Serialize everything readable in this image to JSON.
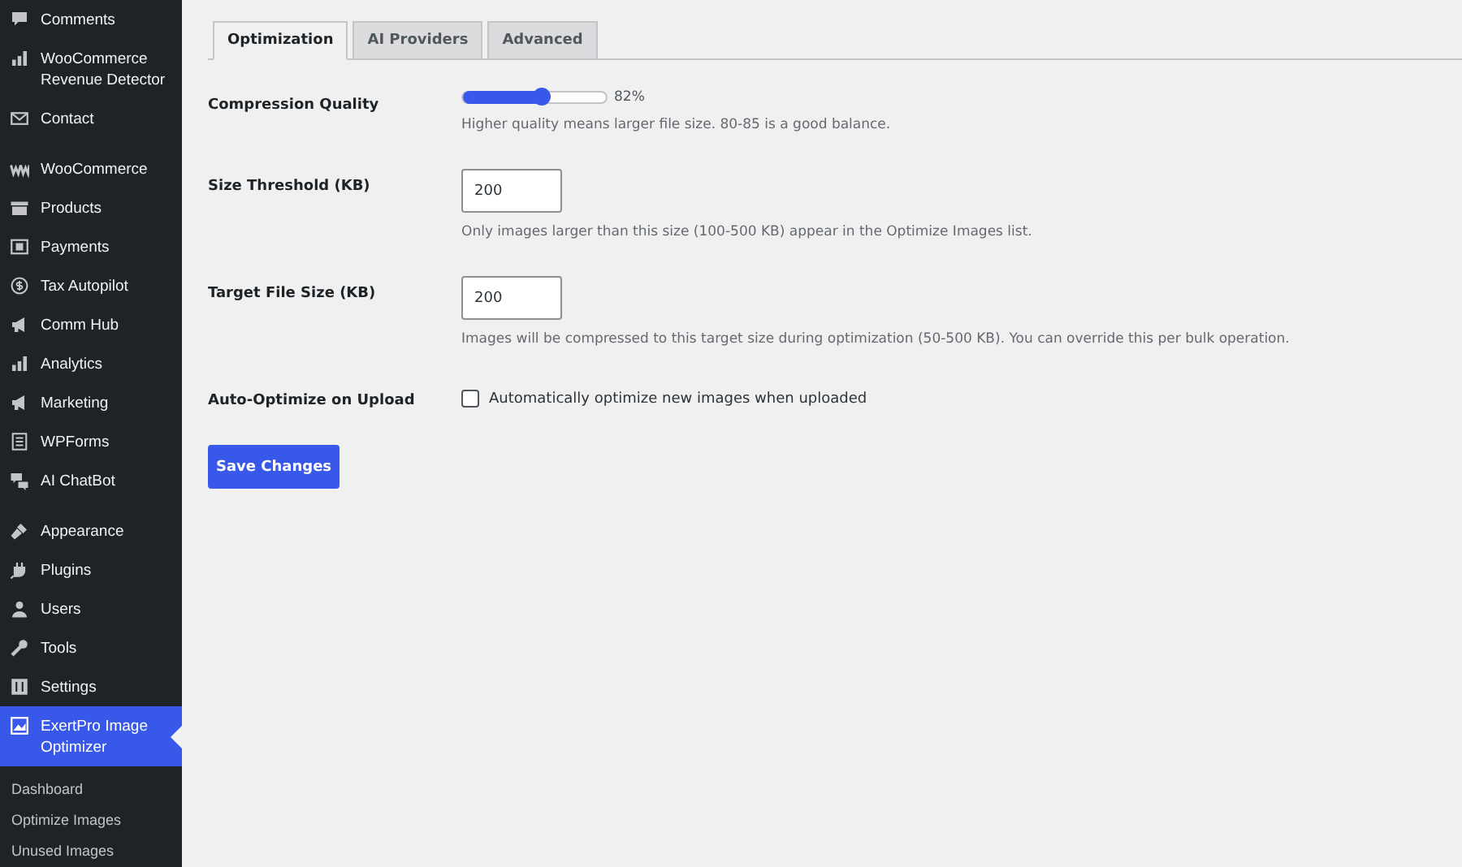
{
  "sidebar": {
    "groups": [
      [
        {
          "label": "Comments",
          "selected": false
        },
        {
          "label": "WooCommerce Revenue Detector",
          "selected": false
        },
        {
          "label": "Contact",
          "selected": false
        }
      ],
      [
        {
          "label": "WooCommerce",
          "selected": false
        },
        {
          "label": "Products",
          "selected": false
        },
        {
          "label": "Payments",
          "selected": false
        },
        {
          "label": "Tax Autopilot",
          "selected": false
        },
        {
          "label": "Comm Hub",
          "selected": false
        },
        {
          "label": "Analytics",
          "selected": false
        },
        {
          "label": "Marketing",
          "selected": false
        },
        {
          "label": "WPForms",
          "selected": false
        },
        {
          "label": "AI ChatBot",
          "selected": false
        }
      ],
      [
        {
          "label": "Appearance",
          "selected": false
        },
        {
          "label": "Plugins",
          "selected": false
        },
        {
          "label": "Users",
          "selected": false
        },
        {
          "label": "Tools",
          "selected": false
        },
        {
          "label": "Settings",
          "selected": false
        },
        {
          "label": "ExertPro Image Optimizer",
          "selected": true
        }
      ]
    ],
    "submenu": [
      {
        "label": "Dashboard"
      },
      {
        "label": "Optimize Images"
      },
      {
        "label": "Unused Images"
      }
    ]
  },
  "tabs": [
    {
      "label": "Optimization",
      "selected": true
    },
    {
      "label": "AI Providers",
      "selected": false
    },
    {
      "label": "Advanced",
      "selected": false
    }
  ],
  "settings": [
    {
      "kind": "slider",
      "label": "Compression Quality",
      "level": 0.55,
      "reading": "82%",
      "description": "Higher quality means larger file size. 80-85 is a good balance."
    },
    {
      "kind": "number",
      "label": "Size Threshold (KB)",
      "value": "200",
      "description": "Only images larger than this size (100-500 KB) appear in the Optimize Images list."
    },
    {
      "kind": "number",
      "label": "Target File Size (KB)",
      "value": "200",
      "description": "Images will be compressed to this target size during optimization (50-500 KB). You can override this per bulk operation."
    },
    {
      "kind": "checkbox",
      "label": "Auto-Optimize on Upload",
      "checked": false,
      "text": "Automatically optimize new images when uploaded"
    }
  ],
  "save_button": "Save Changes"
}
